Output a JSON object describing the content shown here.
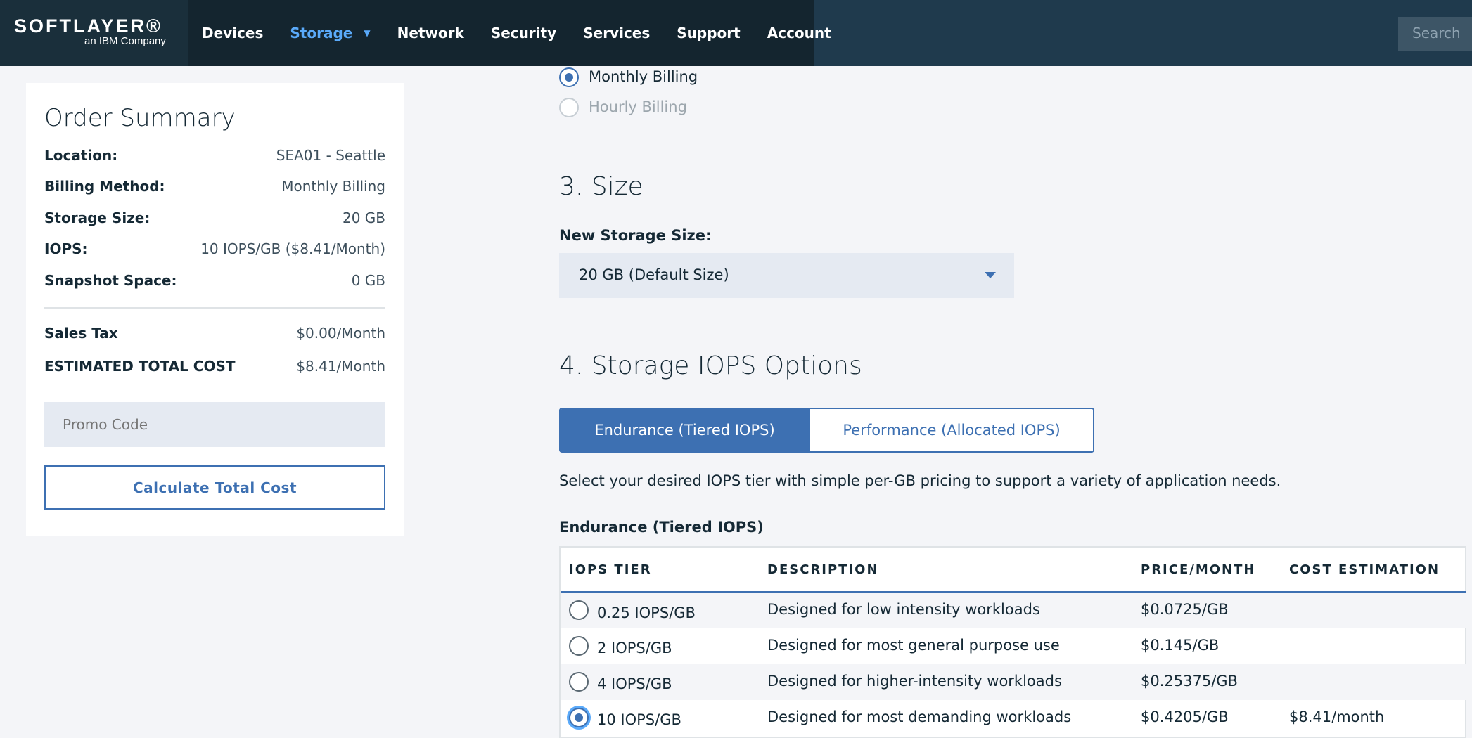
{
  "header": {
    "logo_main": "SOFTLAYER®",
    "logo_sub": "an IBM Company",
    "nav": [
      "Devices",
      "Storage",
      "Network",
      "Security",
      "Services",
      "Support",
      "Account"
    ],
    "search_placeholder": "Search"
  },
  "billing": {
    "monthly": "Monthly Billing",
    "hourly": "Hourly Billing",
    "selected": "Monthly Billing"
  },
  "summary": {
    "title": "Order Summary",
    "rows": [
      {
        "label": "Location:",
        "value": "SEA01 - Seattle"
      },
      {
        "label": "Billing Method:",
        "value": "Monthly Billing"
      },
      {
        "label": "Storage Size:",
        "value": "20 GB"
      },
      {
        "label": "IOPS:",
        "value": "10 IOPS/GB ($8.41/Month)"
      },
      {
        "label": "Snapshot Space:",
        "value": "0 GB"
      }
    ],
    "sales_tax_label": "Sales Tax",
    "sales_tax_value": "$0.00/Month",
    "total_label": "ESTIMATED TOTAL COST",
    "total_value": "$8.41/Month",
    "promo_placeholder": "Promo Code",
    "calc_button": "Calculate Total Cost"
  },
  "size": {
    "title": "3. Size",
    "label": "New Storage Size:",
    "selected": "20 GB (Default Size)"
  },
  "iops": {
    "title": "4. Storage IOPS Options",
    "toggle_on": "Endurance (Tiered IOPS)",
    "toggle_off": "Performance (Allocated IOPS)",
    "description": "Select your desired IOPS tier with simple per-GB pricing to support a variety of application needs.",
    "table_title": "Endurance (Tiered IOPS)",
    "headers": [
      "IOPS TIER",
      "DESCRIPTION",
      "PRICE/MONTH",
      "COST ESTIMATION"
    ],
    "rows": [
      {
        "tier": "0.25 IOPS/GB",
        "description": "Designed for low intensity workloads",
        "price": "$0.0725/GB",
        "cost": ""
      },
      {
        "tier": "2 IOPS/GB",
        "description": "Designed for most general purpose use",
        "price": "$0.145/GB",
        "cost": ""
      },
      {
        "tier": "4 IOPS/GB",
        "description": "Designed for higher-intensity workloads",
        "price": "$0.25375/GB",
        "cost": ""
      },
      {
        "tier": "10 IOPS/GB",
        "description": "Designed for most demanding workloads",
        "price": "$0.4205/GB",
        "cost": "$8.41/month"
      }
    ],
    "selected_tier": "10 IOPS/GB"
  },
  "colors": {
    "accent": "#3d70b2",
    "nav_bg": "#14252f",
    "active_nav": "#5aaafa"
  }
}
